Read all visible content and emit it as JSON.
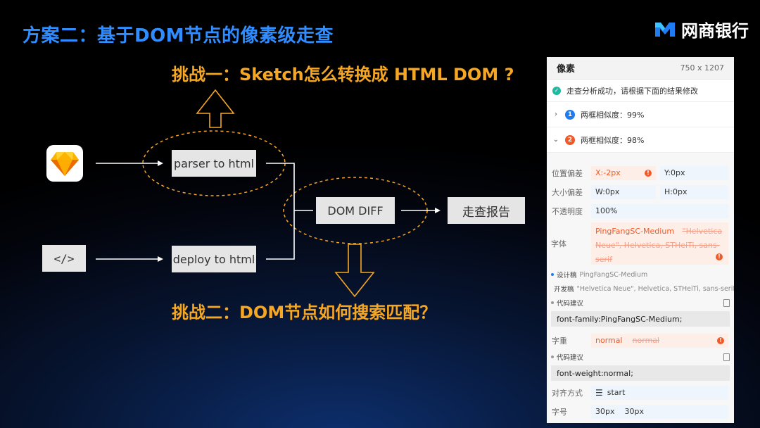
{
  "slide": {
    "title": "方案二：基于DOM节点的像素级走查",
    "logo_text": "网商银行",
    "challenge1": "挑战一：Sketch怎么转换成 HTML DOM ?",
    "challenge2": "挑战二：DOM节点如何搜索匹配？",
    "code_icon": "</>",
    "box_parser": "parser to html",
    "box_deploy": "deploy to html",
    "box_diff": "DOM DIFF",
    "box_report": "走查报告",
    "colors": {
      "title": "#2f8dff",
      "challenge": "#f5a623",
      "accent_error": "#f05a28"
    }
  },
  "panel": {
    "title": "像素",
    "dimensions": "750 x 1207",
    "status": "走查分析成功，请根据下面的结果修改",
    "items": [
      {
        "num": "1",
        "label": "两框相似度：99%",
        "expanded": false
      },
      {
        "num": "2",
        "label": "两框相似度：98%",
        "expanded": true
      }
    ],
    "position": {
      "label": "位置偏差",
      "x": "X:-2px",
      "y": "Y:0px"
    },
    "size": {
      "label": "大小偏差",
      "w": "W:0px",
      "h": "H:0px"
    },
    "opacity": {
      "label": "不透明度",
      "value": "100%"
    },
    "font": {
      "label": "字体",
      "actual": "PingFangSC-Medium",
      "expected": "\"Helvetica Neue\", Helvetica, STHeiTi, sans-serif",
      "design_label": "设计稿",
      "design_value": "PingFangSC-Medium",
      "dev_label": "开发稿",
      "dev_value": "\"Helvetica Neue\", Helvetica, STHeiTi, sans-serif",
      "suggest_label": "代码建议",
      "suggest_code": "font-family:PingFangSC-Medium;"
    },
    "weight": {
      "label": "字重",
      "actual": "normal",
      "expected": "normal",
      "suggest_label": "代码建议",
      "suggest_code": "font-weight:normal;"
    },
    "align": {
      "label": "对齐方式",
      "value": "start"
    },
    "fontsize": {
      "label": "字号",
      "v1": "30px",
      "v2": "30px"
    }
  }
}
